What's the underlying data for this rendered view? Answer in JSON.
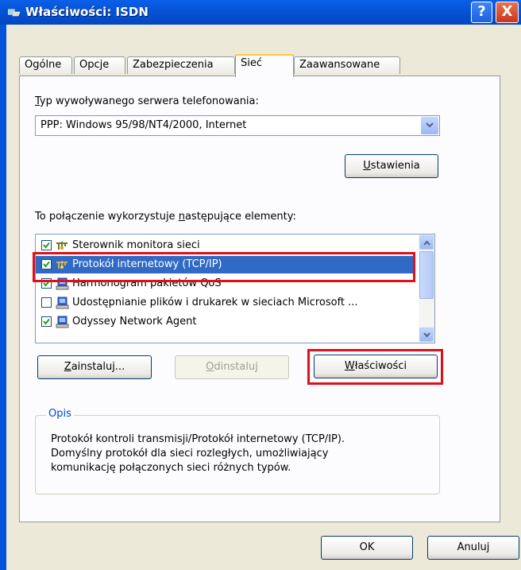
{
  "window": {
    "title": "Właściwości: ISDN",
    "help_label": "?",
    "close_label": "X"
  },
  "tabs": [
    {
      "label": "Ogólne"
    },
    {
      "label": "Opcje"
    },
    {
      "label": "Zabezpieczenia"
    },
    {
      "label": "Sieć",
      "active": true
    },
    {
      "label": "Zaawansowane"
    }
  ],
  "server_type": {
    "label_first": "T",
    "label_rest": "yp wywoływanego serwera telefonowania:",
    "selected": "PPP: Windows 95/98/NT4/2000, Internet",
    "settings_first": "U",
    "settings_rest": "stawienia"
  },
  "components": {
    "label_a": "To połączenie wykorzystuje ",
    "label_underline": "n",
    "label_b": "astępujące elementy:",
    "items": [
      {
        "label": "Sterownik monitora sieci",
        "checked": true,
        "icon": "network-protocol-icon"
      },
      {
        "label": "Protokół internetowy (TCP/IP)",
        "checked": true,
        "selected": true,
        "icon": "network-protocol-icon"
      },
      {
        "label": "Harmonogram pakietów QoS",
        "checked": true,
        "icon": "network-service-icon"
      },
      {
        "label": "Udostępnianie plików i drukarek w sieciach Microsoft ...",
        "checked": false,
        "icon": "network-service-icon"
      },
      {
        "label": "Odyssey Network Agent",
        "checked": true,
        "icon": "network-service-icon"
      }
    ]
  },
  "buttons": {
    "install_first": "Z",
    "install_rest": "ainstaluj...",
    "uninstall_first": "O",
    "uninstall_rest": "dinstaluj",
    "properties_first": "W",
    "properties_rest": "łaściwości",
    "ok": "OK",
    "cancel": "Anuluj"
  },
  "description": {
    "title": "Opis",
    "line1": "Protokół kontroli transmisji/Protokół internetowy (TCP/IP).",
    "line2": "Domyślny protokół dla sieci rozległych, umożliwiający",
    "line3": "komunikację połączonych sieci różnych typów."
  },
  "colors": {
    "titlebar": "#0553d6",
    "selection": "#316ac5",
    "highlight": "#e0101a"
  }
}
